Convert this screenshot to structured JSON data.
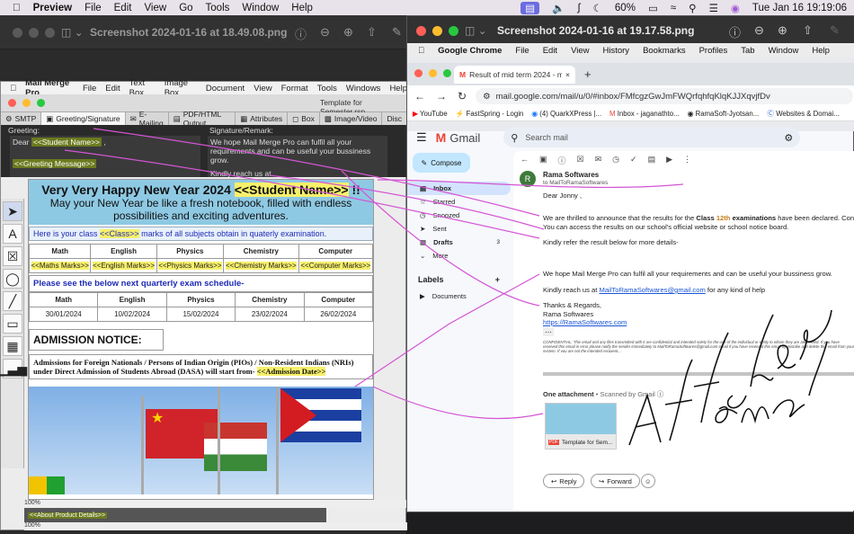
{
  "menubar": {
    "app": "Preview",
    "items": [
      "File",
      "Edit",
      "View",
      "Go",
      "Tools",
      "Window",
      "Help"
    ],
    "battery": "60%",
    "clock": "Tue Jan 16  19:19:06"
  },
  "preview": {
    "title": "Screenshot 2024-01-16 at 18.49.08.png",
    "zoom1": "100%",
    "zoom2": "100%"
  },
  "mergepro": {
    "app": "Mail Merge Pro",
    "menu": [
      "File",
      "Edit",
      "Text Box",
      "Image Box",
      "Document",
      "View",
      "Format",
      "Tools",
      "Windows",
      "Help"
    ],
    "doc_title": "Template for Semester.rsp",
    "tabs": [
      "SMTP",
      "Greeting/Signature",
      "E-Mailing",
      "PDF/HTML Output",
      "Attributes",
      "Box",
      "Image/Video",
      "Disc"
    ],
    "greeting_label": "Greeting:",
    "signature_label": "Signature/Remark:",
    "dear": "Dear",
    "student_tag": "<<Student Name>>",
    "comma": ",",
    "greeting_msg_tag": "<<Greeting Message>>",
    "signature_text": "We hope Mail Merge Pro can fulfil all your requirements and can be useful your bussiness grow.",
    "reach_text": "Kindly reach us at MailToRamaSoftwares@gmail.com for any kind of help",
    "banner_title": "Very Very Happy New Year 2024",
    "banner_excl": "!!",
    "banner_sub": "May your New Year be like a fresh notebook, filled with endless possibilities and exciting adventures.",
    "class_line_pre": "Here is your class",
    "class_tag": "<<Class>>",
    "class_line_post": "marks of all subjects obtain in quaterly examination.",
    "subjects": [
      "Math",
      "English",
      "Physics",
      "Chemistry",
      "Computer"
    ],
    "marks_tags": [
      "<<Maths Marks>>",
      "<<English Marks>>",
      "<<Physics Marks>>",
      "<<Chemistry Marks>>",
      "<<Computer Marks>>"
    ],
    "schedule_title": "Please see the below next quarterly exam schedule-",
    "dates": [
      "30/01/2024",
      "10/02/2024",
      "15/02/2024",
      "23/02/2024",
      "26/02/2024"
    ],
    "admission_title": "ADMISSION NOTICE:",
    "admission_text": "Admissions for Foreign Nationals / Persons of Indian Origin (PIOs) / Non-Resident Indians (NRIs) under Direct Admission of Students Abroad (DASA) will start from-",
    "admission_tag": "<<Admission Date>>",
    "about_tag": "<<About Product Details>>"
  },
  "chrome": {
    "window_title": "Screenshot 2024-01-16 at 19.17.58.png",
    "menu": [
      "Google Chrome",
      "File",
      "Edit",
      "View",
      "History",
      "Bookmarks",
      "Profiles",
      "Tab",
      "Window",
      "Help"
    ],
    "tab_title": "Result of mid term 2024 - ma",
    "url": "mail.google.com/mail/u/0/#inbox/FMfcgzGwJmFWQrfqhfqKlqKJJXqvjfDv",
    "bookmarks": [
      "YouTube",
      "FastSpring - Login",
      "(4) QuarkXPress |...",
      "Inbox - jaganathto...",
      "RamaSoft-Jyotsan...",
      "Websites & Domai..."
    ]
  },
  "gmail": {
    "brand": "Gmail",
    "search_placeholder": "Search mail",
    "compose": "Compose",
    "nav": [
      "Inbox",
      "Starred",
      "Snoozed",
      "Sent",
      "Drafts",
      "More"
    ],
    "drafts_count": "3",
    "labels_heading": "Labels",
    "labels": [
      "Documents"
    ],
    "sender": "Rama Softwares",
    "to": "to MailToRamaSoftwares",
    "greeting": "Dear  Jonny ,",
    "p1_pre": "We are thrilled to announce that the results for the",
    "p1_class": "Class",
    "p1_grade": "12th",
    "p1_exam": "examinations",
    "p1_post": "have been declared. Congra",
    "p1_line2": "You can access the results on our school's official website or school notice board.",
    "p2": "Kindly refer the result below for more details-",
    "p3": "We hope Mail Merge Pro can fulfil all your requirements and can be useful your bussiness grow.",
    "p4_pre": "Kindly reach us at",
    "p4_link": "MailToRamaSoftwares@gmail.com",
    "p4_post": "for any kind of help",
    "regards": "Thanks & Regards,",
    "sig_name": "Rama Softwares",
    "sig_link": "https://RamaSoftwares.com",
    "confidential": "CONFIDENTIAL: This email and any files transmitted with it are confidential and intended solely for the use of the individual or entity to whom they are addressed. If you have received this email in error please notify the sender immediately to MailToRamaSoftwares@gmail.com email if you have received this email by mistake and delete this email from your system. If you are not the intended recipient...",
    "attach_label": "One attachment",
    "scanned": "• Scanned by Gmail",
    "attach_name": "Template for Sem...",
    "reply": "Reply",
    "forward": "Forward"
  },
  "annotation": {
    "handwriting": "Attached email"
  },
  "colors": {
    "merge_tag": "#6b7a1e",
    "banner": "#8ec9e3",
    "highlight": "#f7f06b",
    "arrow": "#d455d4",
    "gmail_red": "#ea4335",
    "link": "#1a55d6"
  }
}
